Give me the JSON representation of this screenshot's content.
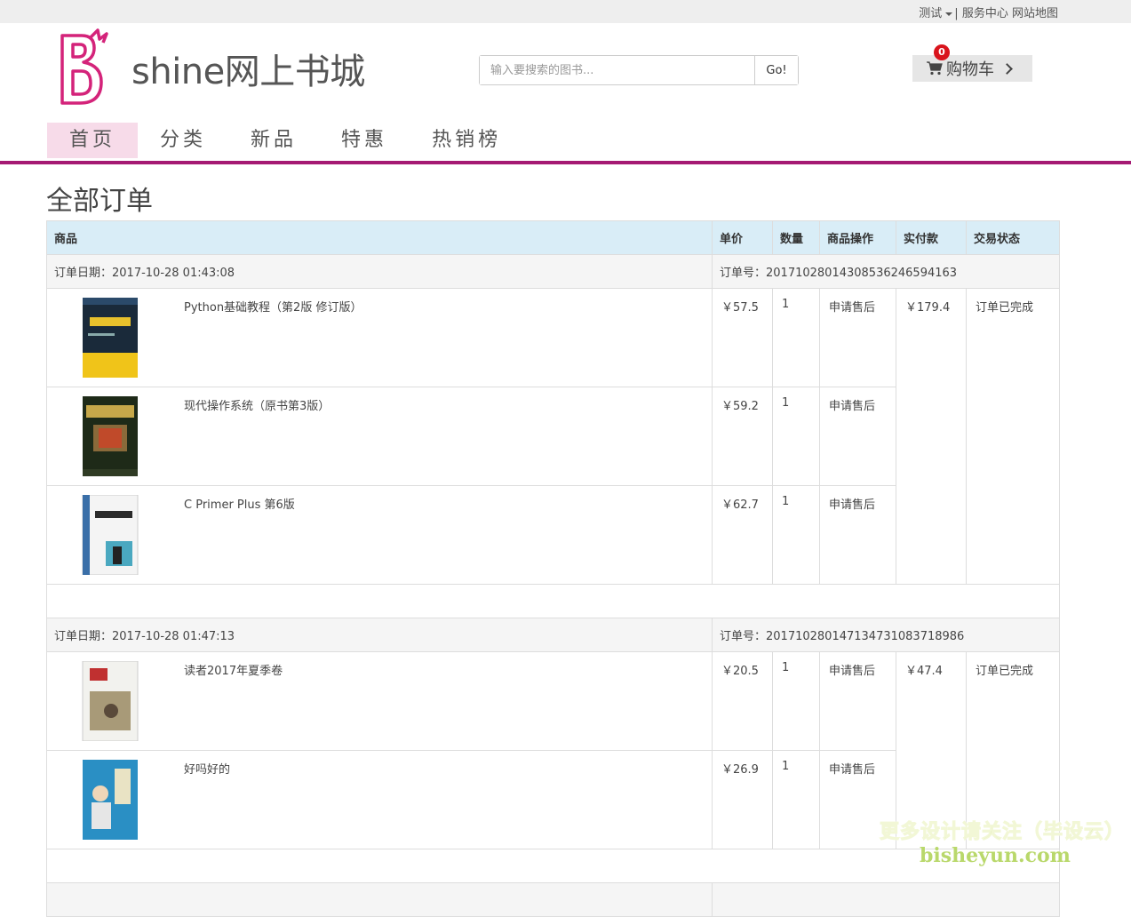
{
  "topbar": {
    "user": "测试",
    "links_sep": "|",
    "service": "服务中心",
    "sitemap": "网站地图"
  },
  "header": {
    "title": "shine网上书城",
    "search_placeholder": "输入要搜索的图书...",
    "search_button": "Go!",
    "cart_label": "购物车",
    "cart_count": "0"
  },
  "nav": {
    "items": [
      "首页",
      "分类",
      "新品",
      "特惠",
      "热销榜"
    ],
    "active_index": 0
  },
  "page_title": "全部订单",
  "table_headers": {
    "product": "商品",
    "price": "单价",
    "qty": "数量",
    "action": "商品操作",
    "paid": "实付款",
    "status": "交易状态"
  },
  "orders": [
    {
      "date_label": "订单日期：2017-10-28 01:43:08",
      "no_label": "订单号：20171028014308536246594163",
      "paid": "￥179.4",
      "status": "订单已完成",
      "items": [
        {
          "name": "Python基础教程（第2版 修订版）",
          "price": "￥57.5",
          "qty": "1",
          "action": "申请售后",
          "cover": "python-book-cover"
        },
        {
          "name": "现代操作系统（原书第3版）",
          "price": "￥59.2",
          "qty": "1",
          "action": "申请售后",
          "cover": "os-book-cover"
        },
        {
          "name": "C Primer Plus 第6版",
          "price": "￥62.7",
          "qty": "1",
          "action": "申请售后",
          "cover": "c-primer-book-cover"
        }
      ]
    },
    {
      "date_label": "订单日期：2017-10-28 01:47:13",
      "no_label": "订单号：20171028014713473108371898​6",
      "paid": "￥47.4",
      "status": "订单已完成",
      "items": [
        {
          "name": "读者2017年夏季卷",
          "price": "￥20.5",
          "qty": "1",
          "action": "申请售后",
          "cover": "duzhe-book-cover"
        },
        {
          "name": "好吗好的",
          "price": "￥26.9",
          "qty": "1",
          "action": "申请售后",
          "cover": "haomahaode-book-cover"
        }
      ]
    }
  ],
  "watermark": {
    "line1": "更多设计请关注（毕设云）",
    "line2": "bisheyun.com"
  },
  "colors": {
    "brand": "#a51a73",
    "nav_active_bg": "#f7dbe9",
    "table_header_bg": "#d9edf7",
    "badge": "#d9141c"
  }
}
